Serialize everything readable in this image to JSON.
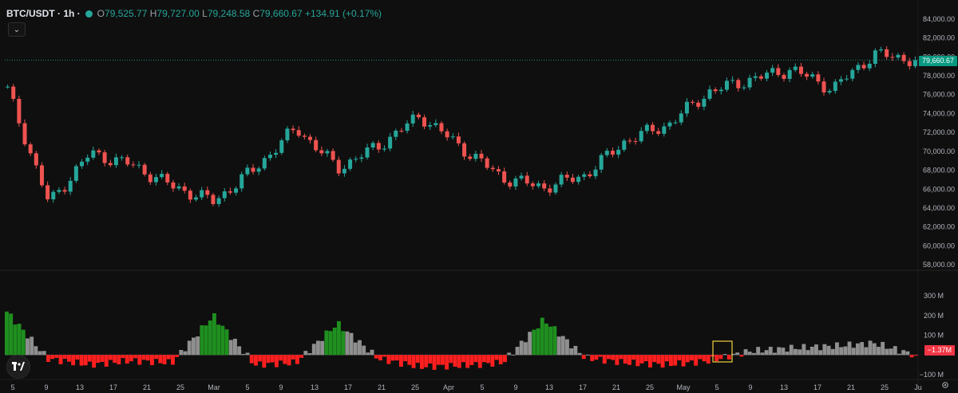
{
  "header": {
    "symbol": "BTC/USDT · 1h ·",
    "open_label": "O",
    "open": "79,525.77",
    "high_label": "H",
    "high": "79,727.00",
    "low_label": "L",
    "low": "79,248.58",
    "close_label": "C",
    "close": "79,660.67",
    "change": "+134.91 (+0.17%)"
  },
  "price_tag": "79,660.67",
  "delta_tag": "−1.37M",
  "colors": {
    "up": "#26a69a",
    "down": "#ef5350",
    "delta_pos": "#1f8f1f",
    "delta_neg": "#ff1f1f",
    "delta_neutral": "#8f8f8f",
    "price_tag": "#089981",
    "highlight": "#f4d03f"
  },
  "icons": {
    "collapse": "chevron-down-icon",
    "logo": "tradingview-logo-icon",
    "settings": "gear-icon"
  },
  "chart_data": [
    {
      "type": "line",
      "title": "",
      "price_axis_ticks": [
        "84,000.00",
        "82,000.00",
        "80,000.00",
        "78,000.00",
        "76,000.00",
        "74,000.00",
        "72,000.00",
        "70,000.00",
        "68,000.00",
        "66,000.00",
        "64,000.00",
        "62,000.00",
        "60,000.00",
        "58,000.00"
      ],
      "ylim": [
        57500,
        84500
      ],
      "x": [
        "5",
        "9",
        "13",
        "17",
        "21",
        "25",
        "Mar",
        "5",
        "9",
        "13",
        "17",
        "21",
        "25",
        "Apr",
        "5",
        "9",
        "13",
        "17",
        "21",
        "25",
        "May",
        "5",
        "9"
      ],
      "y": [
        76500,
        64500,
        69800,
        68600,
        66300,
        64700,
        68200,
        72500,
        68200,
        70600,
        73800,
        70400,
        67200,
        66200,
        67500,
        71200,
        72800,
        76300,
        77600,
        78700,
        76600,
        80300,
        79661
      ],
      "last_price": 79660.67
    },
    {
      "type": "bar",
      "title": "",
      "axis_ticks": [
        "300 M",
        "200 M",
        "100 M",
        "−100 M"
      ],
      "ylim": [
        -100,
        300
      ],
      "x_ticks": [
        "5",
        "9",
        "13",
        "17",
        "21",
        "25",
        "Mar",
        "5",
        "9",
        "13",
        "17",
        "21",
        "25",
        "Apr",
        "5",
        "9",
        "13",
        "17",
        "21",
        "25",
        "May",
        "5",
        "9",
        "13",
        "17",
        "21",
        "25",
        "Ju"
      ],
      "categories": [
        "5",
        "9",
        "13",
        "17",
        "21",
        "25",
        "Mar",
        "5",
        "9",
        "13",
        "17",
        "21",
        "25",
        "Apr",
        "5",
        "9",
        "13",
        "17",
        "21",
        "25",
        "May",
        "5",
        "9"
      ],
      "values": [
        220,
        -20,
        -50,
        -30,
        -40,
        200,
        -50,
        -40,
        160,
        -20,
        -60,
        -55,
        -40,
        180,
        -15,
        -40,
        -50,
        -30,
        20,
        35,
        45,
        60,
        -1.37
      ],
      "last_value": -1.37
    }
  ]
}
